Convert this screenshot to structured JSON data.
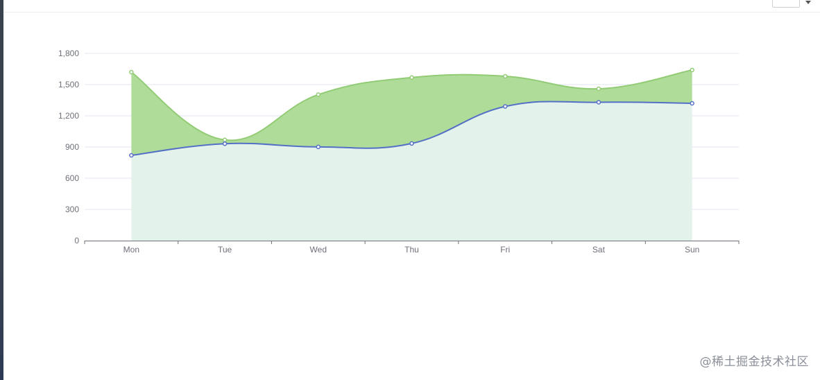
{
  "watermark": "@稀土掘金技术社区",
  "colors": {
    "series_a_line": "#91cc75",
    "series_a_fill": "#b0dc9a",
    "series_b_line": "#5470c6",
    "series_b_fill": "#e3f2ea",
    "axis": "#6e7079",
    "grid": "#e0e6f1"
  },
  "chart_data": {
    "type": "area",
    "categories": [
      "Mon",
      "Tue",
      "Wed",
      "Thu",
      "Fri",
      "Sat",
      "Sun"
    ],
    "ylim": [
      0,
      1800
    ],
    "yticks": [
      0,
      300,
      600,
      900,
      1200,
      1500,
      1800
    ],
    "ytick_labels": [
      "0",
      "300",
      "600",
      "900",
      "1,200",
      "1,500",
      "1,800"
    ],
    "grid": true,
    "smooth": true,
    "series": [
      {
        "values": [
          1620,
          968,
          1404,
          1568,
          1580,
          1460,
          1640
        ]
      },
      {
        "values": [
          820,
          932,
          901,
          934,
          1290,
          1330,
          1320
        ]
      }
    ],
    "title": "",
    "xlabel": "",
    "ylabel": ""
  }
}
